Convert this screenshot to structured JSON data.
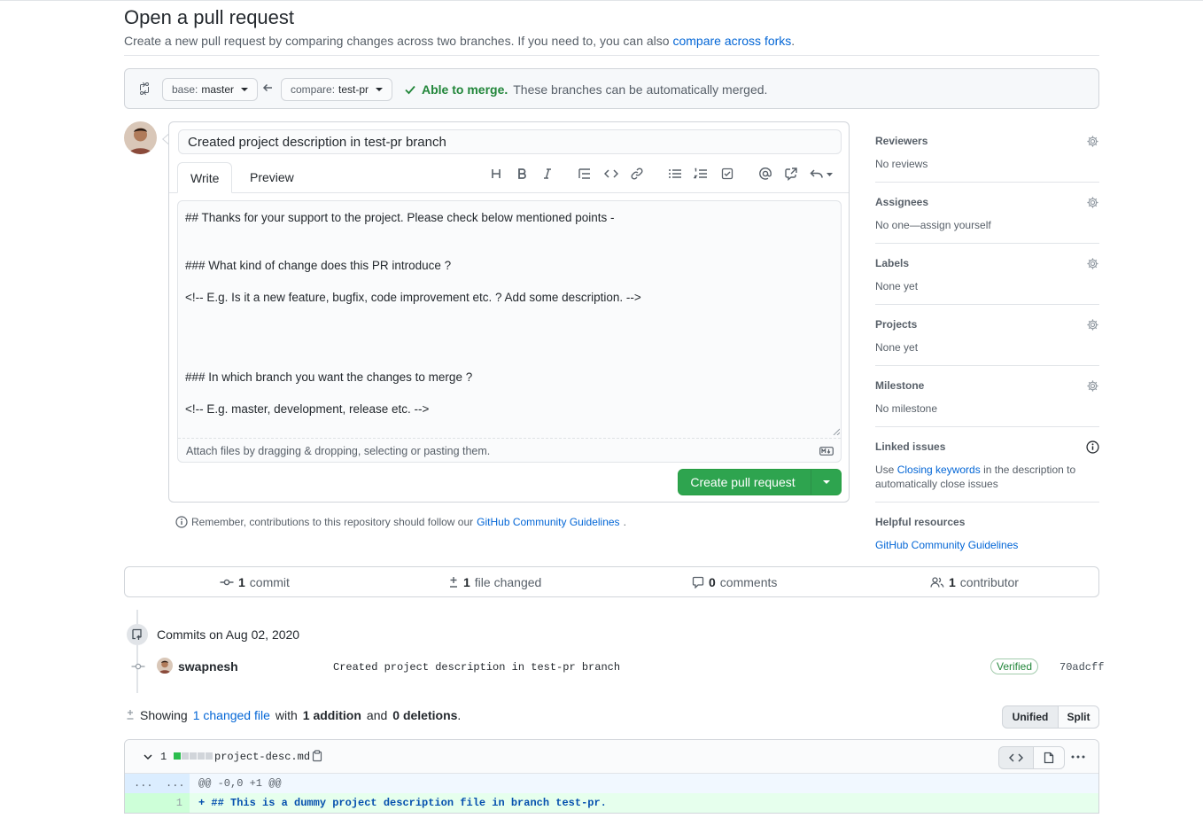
{
  "header": {
    "title": "Open a pull request",
    "subtitle": "Create a new pull request by comparing changes across two branches. If you need to, you can also",
    "subtitle_link": "compare across forks",
    "subtitle_end": "."
  },
  "range": {
    "base_label": "base:",
    "base_value": "master",
    "compare_label": "compare:",
    "compare_value": "test-pr",
    "merge_ok": "Able to merge.",
    "merge_text": "These branches can be automatically merged."
  },
  "compose": {
    "title_value": "Created project description in test-pr branch",
    "tab_write": "Write",
    "tab_preview": "Preview",
    "body_lines": [
      "## Thanks for your support to the project. Please check below mentioned points -",
      "",
      "",
      "### What kind of change does this PR introduce ?",
      "",
      "<!-- E.g. Is it a new feature, bugfix, code improvement etc. ? Add some description. -->",
      "",
      "",
      "",
      "",
      "### In which branch you want the changes to merge ?",
      "",
      "<!-- E.g. master, development, release etc. -->"
    ],
    "attach_text": "Attach files by dragging & dropping, selecting or pasting them.",
    "create_button": "Create pull request"
  },
  "remember": {
    "text": "Remember, contributions to this repository should follow our",
    "link": "GitHub Community Guidelines",
    "end": "."
  },
  "sidebar": {
    "reviewers": {
      "label": "Reviewers",
      "value": "No reviews"
    },
    "assignees": {
      "label": "Assignees",
      "value": "No one—assign yourself"
    },
    "labels": {
      "label": "Labels",
      "value": "None yet"
    },
    "projects": {
      "label": "Projects",
      "value": "None yet"
    },
    "milestone": {
      "label": "Milestone",
      "value": "No milestone"
    },
    "linked": {
      "label": "Linked issues",
      "pre": "Use",
      "link": "Closing keywords",
      "post": "in the description to automatically close issues"
    },
    "helpful": {
      "label": "Helpful resources",
      "link": "GitHub Community Guidelines"
    }
  },
  "stats": {
    "commits_count": "1",
    "commits_label": "commit",
    "files_count": "1",
    "files_label": "file changed",
    "comments_count": "0",
    "comments_label": "comments",
    "contributors_count": "1",
    "contributors_label": "contributor"
  },
  "commits": {
    "heading": "Commits on Aug 02, 2020",
    "author": "swapnesh",
    "message": "Created project description in test-pr branch",
    "verified": "Verified",
    "sha": "70adcff"
  },
  "showing": {
    "pre": "Showing",
    "link": "1 changed file",
    "with": "with",
    "additions": "1 addition",
    "and": "and",
    "deletions": "0 deletions",
    "end": ".",
    "unified": "Unified",
    "split": "Split"
  },
  "diff": {
    "change_count": "1",
    "filename": "project-desc.md",
    "hunk_old": "...",
    "hunk_new": "...",
    "hunk_header": "@@ -0,0 +1 @@",
    "line_number": "1",
    "added_line": "+ ## This is a dummy project description file in branch test-pr."
  },
  "colors": {
    "accent": "#0366d6",
    "success": "#2ea44f",
    "success_text": "#22863a",
    "border": "#d1d5da"
  },
  "icons": [
    "git-compare-icon",
    "arrow-left-icon",
    "check-icon",
    "heading-icon",
    "bold-icon",
    "italic-icon",
    "quote-icon",
    "code-icon",
    "link-icon",
    "list-unordered-icon",
    "list-ordered-icon",
    "tasklist-icon",
    "mention-icon",
    "cross-reference-icon",
    "reply-icon",
    "markdown-icon",
    "info-icon",
    "gear-icon",
    "commit-icon",
    "diff-icon",
    "comment-icon",
    "people-icon",
    "chevron-down-icon",
    "copy-icon",
    "file-icon",
    "kebab-icon"
  ]
}
